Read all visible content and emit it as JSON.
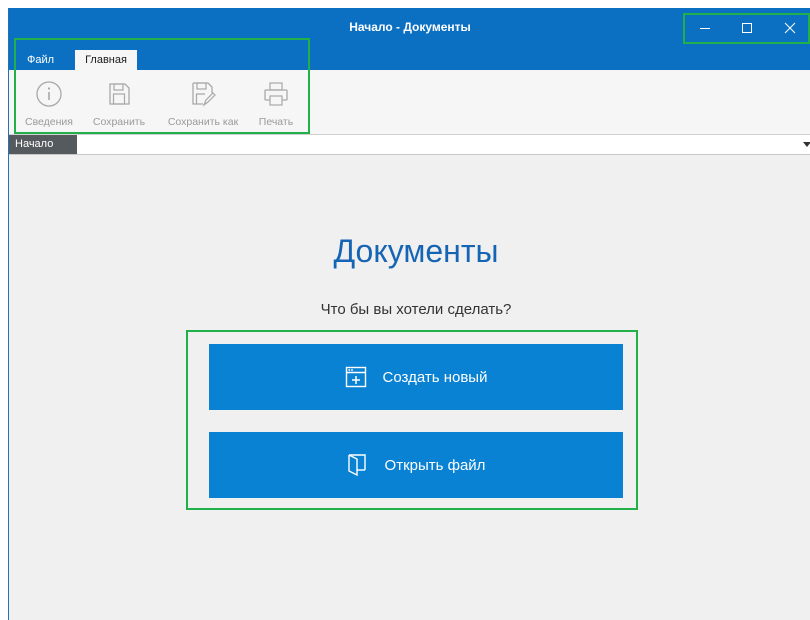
{
  "window": {
    "title": "Начало - Документы"
  },
  "menu_tabs": {
    "file": "Файл",
    "home": "Главная"
  },
  "ribbon": {
    "info": {
      "label": "Сведения",
      "icon": "info-icon"
    },
    "save": {
      "label": "Сохранить",
      "icon": "save-icon"
    },
    "save_as": {
      "label": "Сохранить как",
      "icon": "save-as-icon"
    },
    "print": {
      "label": "Печать",
      "icon": "print-icon"
    }
  },
  "doc_tabs": {
    "active": "Начало"
  },
  "start": {
    "heading": "Документы",
    "question": "Что бы вы хотели сделать?",
    "create_new": {
      "label": "Создать новый",
      "icon": "new-document-icon"
    },
    "open_file": {
      "label": "Открыть файл",
      "icon": "open-file-icon"
    }
  },
  "colors": {
    "title_bar": "#0b6fc2",
    "primary_button": "#0a82d4",
    "heading": "#1565b4",
    "highlight": "#22b04a"
  }
}
